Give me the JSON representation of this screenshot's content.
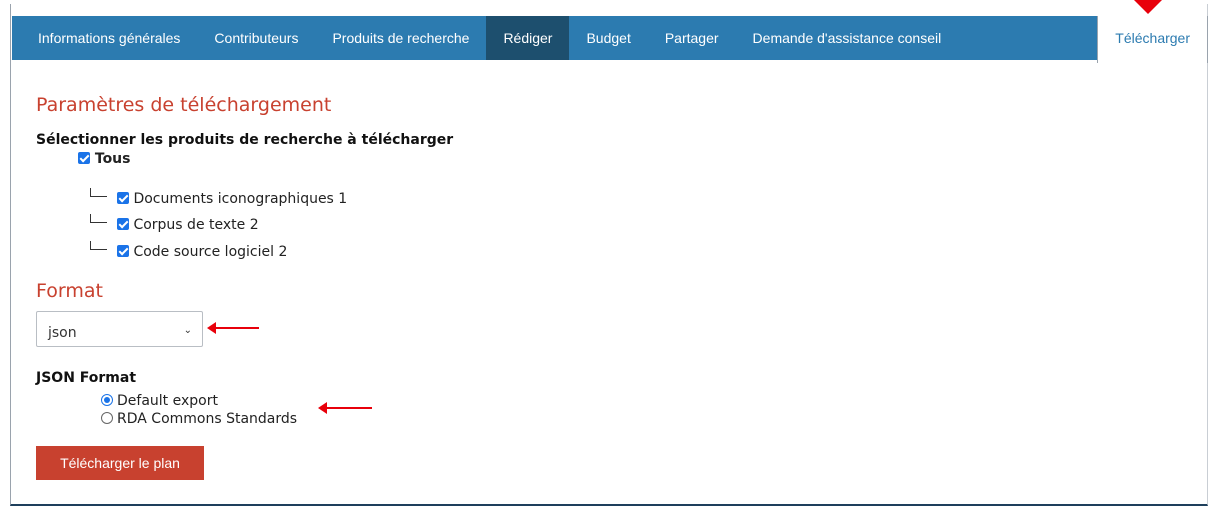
{
  "tabs": [
    {
      "label": "Informations générales"
    },
    {
      "label": "Contributeurs"
    },
    {
      "label": "Produits de recherche"
    },
    {
      "label": "Rédiger"
    },
    {
      "label": "Budget"
    },
    {
      "label": "Partager"
    },
    {
      "label": "Demande d'assistance conseil"
    },
    {
      "label": "Télécharger"
    }
  ],
  "params": {
    "heading": "Paramètres de téléchargement",
    "select_label": "Sélectionner les produits de recherche à télécharger",
    "all_label": "Tous",
    "products": [
      {
        "label": "Documents iconographiques 1",
        "checked": true
      },
      {
        "label": "Corpus de texte 2",
        "checked": true
      },
      {
        "label": "Code source logiciel 2",
        "checked": true
      }
    ]
  },
  "format": {
    "heading": "Format",
    "selected": "json",
    "json_label": "JSON Format",
    "options": [
      {
        "label": "Default export",
        "selected": true
      },
      {
        "label": "RDA Commons Standards",
        "selected": false
      }
    ]
  },
  "download_button": "Télécharger le plan",
  "colors": {
    "tab_bar": "#2c7bb0",
    "accent": "#c8412f",
    "annotation_arrow": "#e8000b"
  }
}
